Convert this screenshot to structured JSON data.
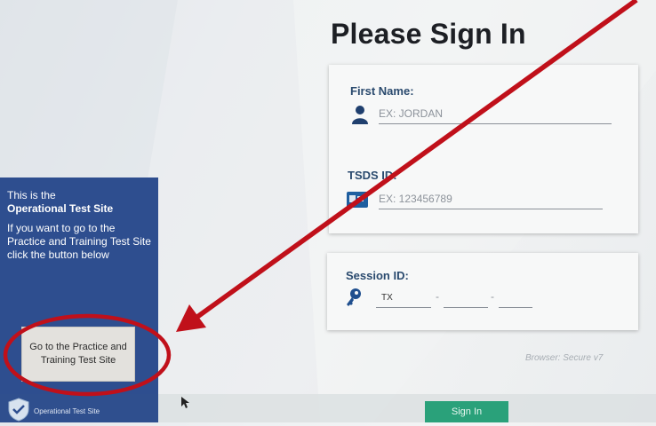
{
  "page": {
    "title": "Please Sign In"
  },
  "form": {
    "first_name": {
      "label": "First Name:",
      "placeholder": "EX: JORDAN",
      "icon": "person-icon"
    },
    "tsds_id": {
      "label": "TSDS ID:",
      "placeholder": "EX: 123456789",
      "icon": "id-card-icon"
    },
    "session_id": {
      "label": "Session ID:",
      "prefix_value": "TX",
      "separator": "-",
      "icon": "key-icon"
    }
  },
  "browser_version": "Browser: Secure v7",
  "info_panel": {
    "line1": "This is the",
    "line2": "Operational Test Site",
    "line3": "If you want to go to the Practice and Training Test Site click the button below",
    "button_label": "Go to the Practice and Training Test Site"
  },
  "footer": {
    "site_label": "Operational Test Site",
    "icon": "shield-check-icon"
  },
  "signin_button": "Sign In",
  "colors": {
    "panel_blue": "#2e4e8f",
    "signin_green": "#2aa17a",
    "annotation_red": "#c0101a",
    "label_blue": "#2a4a6e"
  }
}
